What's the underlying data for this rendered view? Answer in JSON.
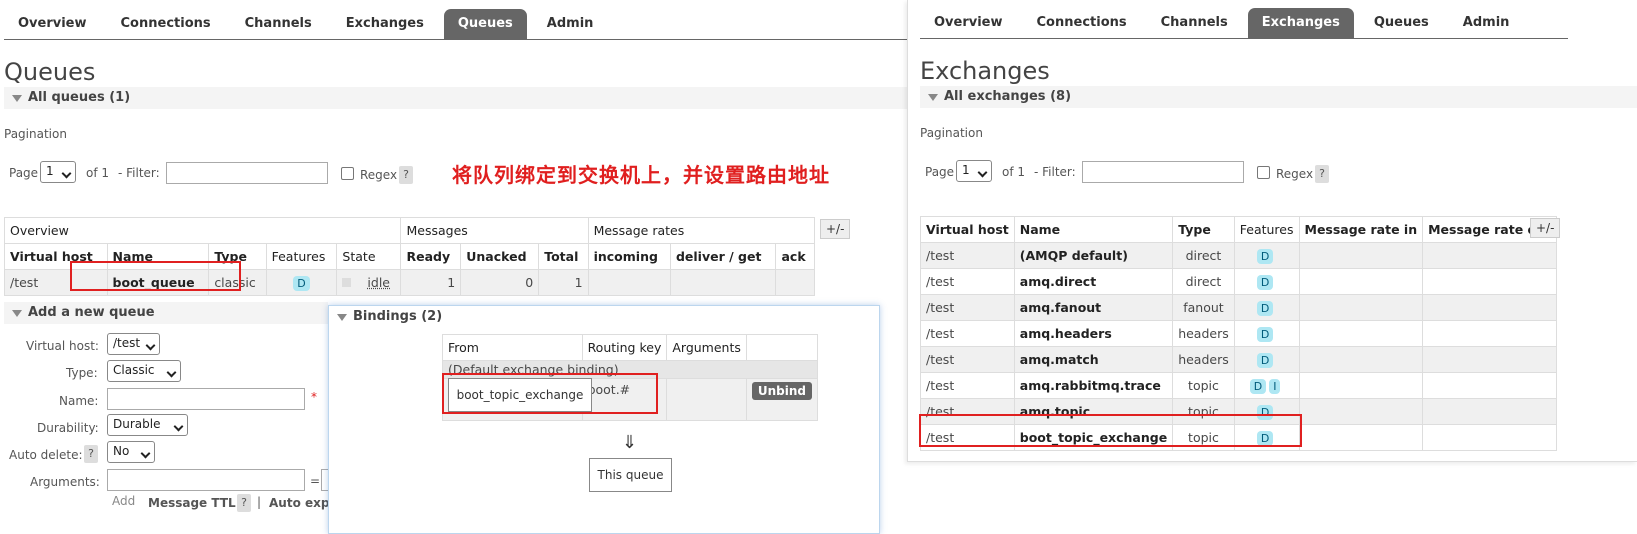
{
  "left": {
    "nav": [
      "Overview",
      "Connections",
      "Channels",
      "Exchanges",
      "Queues",
      "Admin"
    ],
    "active_tab": "Queues",
    "title": "Queues",
    "all_queues": "All queues (1)",
    "pagination_label": "Pagination",
    "page_label": "Page",
    "page_value": "1",
    "of": "of 1",
    "filter_label": "- Filter:",
    "regex_label": "Regex",
    "help": "?",
    "annotation": "将队列绑定到交换机上，并设置路由地址",
    "table": {
      "groups": [
        "Overview",
        "Messages",
        "Message rates"
      ],
      "plusminus": "+/-",
      "headers": [
        "Virtual host",
        "Name",
        "Type",
        "Features",
        "State",
        "Ready",
        "Unacked",
        "Total",
        "incoming",
        "deliver / get",
        "ack"
      ],
      "row": {
        "vhost": "/test",
        "name": "boot_queue",
        "type": "classic",
        "feature": "D",
        "state": "idle",
        "ready": "1",
        "unacked": "0",
        "total": "1"
      }
    },
    "add_queue": {
      "title": "Add a new queue",
      "virtual_host_label": "Virtual host:",
      "virtual_host": "/test",
      "type_label": "Type:",
      "type": "Classic",
      "name_label": "Name:",
      "required": "*",
      "durability_label": "Durability:",
      "durability": "Durable",
      "auto_delete_label": "Auto delete:",
      "auto_delete": "No",
      "arguments_label": "Arguments:",
      "eq": "=",
      "add": "Add",
      "ttl": "Message TTL",
      "sep": "|",
      "auto_expire": "Auto expi"
    }
  },
  "bindings": {
    "title": "Bindings (2)",
    "headers": [
      "From",
      "Routing key",
      "Arguments"
    ],
    "default_row": "(Default exchange binding)",
    "from": "boot_topic_exchange",
    "routing_key": "boot.#",
    "unbind": "Unbind",
    "arrow": "⇓",
    "this_queue": "This queue"
  },
  "right": {
    "nav": [
      "Overview",
      "Connections",
      "Channels",
      "Exchanges",
      "Queues",
      "Admin"
    ],
    "active_tab": "Exchanges",
    "title": "Exchanges",
    "all_exchanges": "All exchanges (8)",
    "pagination_label": "Pagination",
    "page_label": "Page",
    "page_value": "1",
    "of": "of 1",
    "filter_label": "- Filter:",
    "regex_label": "Regex",
    "help": "?",
    "plusminus": "+/-",
    "headers": [
      "Virtual host",
      "Name",
      "Type",
      "Features",
      "Message rate in",
      "Message rate out"
    ],
    "rows": [
      {
        "vhost": "/test",
        "name": "(AMQP default)",
        "type": "direct",
        "features": [
          "D"
        ]
      },
      {
        "vhost": "/test",
        "name": "amq.direct",
        "type": "direct",
        "features": [
          "D"
        ]
      },
      {
        "vhost": "/test",
        "name": "amq.fanout",
        "type": "fanout",
        "features": [
          "D"
        ]
      },
      {
        "vhost": "/test",
        "name": "amq.headers",
        "type": "headers",
        "features": [
          "D"
        ]
      },
      {
        "vhost": "/test",
        "name": "amq.match",
        "type": "headers",
        "features": [
          "D"
        ]
      },
      {
        "vhost": "/test",
        "name": "amq.rabbitmq.trace",
        "type": "topic",
        "features": [
          "D",
          "I"
        ]
      },
      {
        "vhost": "/test",
        "name": "amq.topic",
        "type": "topic",
        "features": [
          "D"
        ]
      },
      {
        "vhost": "/test",
        "name": "boot_topic_exchange",
        "type": "topic",
        "features": [
          "D"
        ]
      }
    ]
  },
  "colors": {
    "active_tab": "#666666",
    "highlight": "#e02020",
    "badge": "#aee7f3"
  }
}
